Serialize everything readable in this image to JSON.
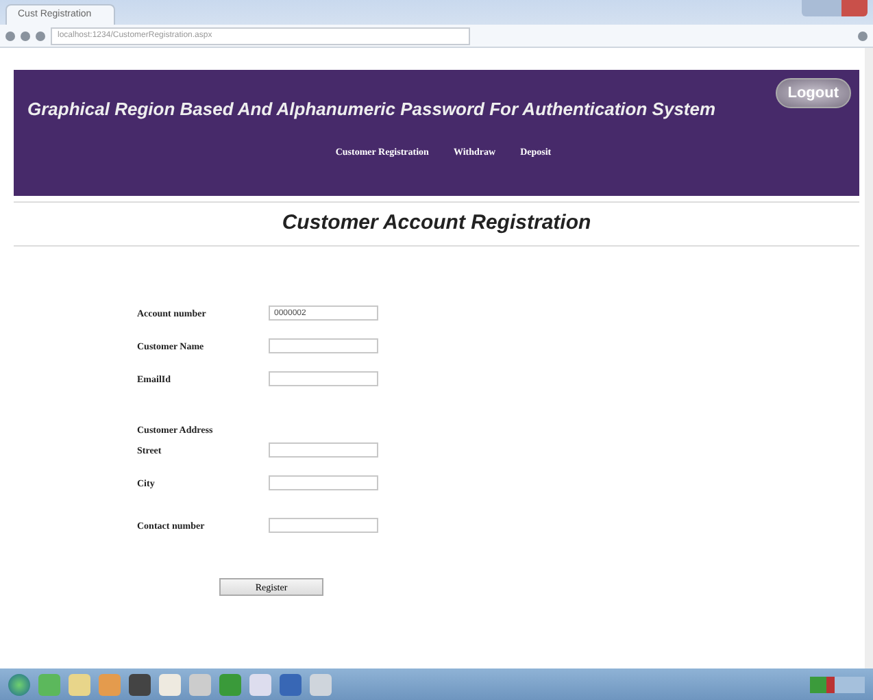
{
  "browser": {
    "tab_title": "Cust Registration",
    "address": "localhost:1234/CustomerRegistration.aspx"
  },
  "header": {
    "title": "Graphical Region Based And Alphanumeric Password For Authentication System",
    "logout": "Logout",
    "nav": [
      {
        "label": "Customer Registration"
      },
      {
        "label": "Withdraw"
      },
      {
        "label": "Deposit"
      }
    ]
  },
  "page_title": "Customer Account Registration",
  "form": [
    {
      "kind": "field",
      "label": "Account number",
      "value": "0000002"
    },
    {
      "kind": "field",
      "label": "Customer Name"
    },
    {
      "kind": "field",
      "label": "EmailId"
    },
    {
      "kind": "heading",
      "label": "Customer Address"
    },
    {
      "kind": "field",
      "label": "Street"
    },
    {
      "kind": "field",
      "label": "City"
    },
    {
      "kind": "field",
      "label": "Contact number"
    }
  ],
  "submit": "Register"
}
